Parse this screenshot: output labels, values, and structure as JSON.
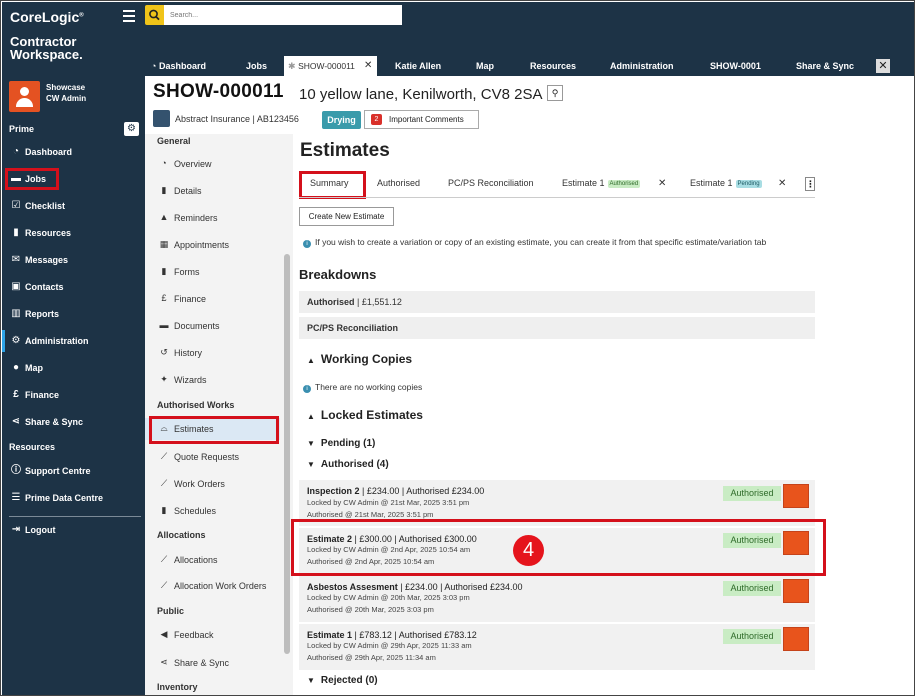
{
  "app": {
    "logo_text": "CoreLogic",
    "logo_mark": "®",
    "product_line1": "Contractor",
    "product_line2": "Workspace."
  },
  "user": {
    "name": "Showcase",
    "role": "CW Admin"
  },
  "sidebar": {
    "section_prime": "Prime",
    "section_resources": "Resources",
    "items": [
      {
        "label": "Dashboard",
        "icon": "dashboard-icon"
      },
      {
        "label": "Jobs",
        "icon": "folder-icon"
      },
      {
        "label": "Checklist",
        "icon": "checkbox-icon"
      },
      {
        "label": "Resources",
        "icon": "clipboard-icon"
      },
      {
        "label": "Messages",
        "icon": "envelope-icon"
      },
      {
        "label": "Contacts",
        "icon": "contact-card-icon"
      },
      {
        "label": "Reports",
        "icon": "chart-icon"
      },
      {
        "label": "Administration",
        "icon": "gear-icon"
      },
      {
        "label": "Map",
        "icon": "map-pin-icon"
      },
      {
        "label": "Finance",
        "icon": "pound-icon"
      },
      {
        "label": "Share & Sync",
        "icon": "share-icon"
      }
    ],
    "resource_items": [
      {
        "label": "Support Centre",
        "icon": "info-icon"
      },
      {
        "label": "Prime Data Centre",
        "icon": "database-icon"
      }
    ],
    "logout": "Logout"
  },
  "search": {
    "placeholder": "Search..."
  },
  "tabs": [
    {
      "label": "Dashboard"
    },
    {
      "label": "Jobs"
    },
    {
      "label": "SHOW-000011",
      "active": true
    },
    {
      "label": "Katie Allen"
    },
    {
      "label": "Map"
    },
    {
      "label": "Resources"
    },
    {
      "label": "Administration"
    },
    {
      "label": "SHOW-0001"
    },
    {
      "label": "Share & Sync"
    }
  ],
  "job": {
    "id": "SHOW-000011",
    "address": "10 yellow lane, Kenilworth, CV8 2SA",
    "insurer": "Abstract Insurance | AB123456",
    "status": "Drying",
    "important_count": "2",
    "important_label": "Important Comments"
  },
  "subnav": {
    "section_general": "General",
    "general_items": [
      {
        "label": "Overview",
        "icon": "overview-icon"
      },
      {
        "label": "Details",
        "icon": "document-icon"
      },
      {
        "label": "Reminders",
        "icon": "bell-icon"
      },
      {
        "label": "Appointments",
        "icon": "calendar-icon"
      },
      {
        "label": "Forms",
        "icon": "form-icon"
      },
      {
        "label": "Finance",
        "icon": "pound-icon"
      },
      {
        "label": "Documents",
        "icon": "folder-icon"
      },
      {
        "label": "History",
        "icon": "history-icon"
      },
      {
        "label": "Wizards",
        "icon": "wand-icon"
      }
    ],
    "section_authorised": "Authorised Works",
    "authorised_items": [
      {
        "label": "Estimates",
        "icon": "estimate-icon"
      },
      {
        "label": "Quote Requests",
        "icon": "hammer-icon"
      },
      {
        "label": "Work Orders",
        "icon": "wrench-icon"
      },
      {
        "label": "Schedules",
        "icon": "clipboard-icon"
      }
    ],
    "section_allocations": "Allocations",
    "allocation_items": [
      {
        "label": "Allocations",
        "icon": "wrench-icon"
      },
      {
        "label": "Allocation Work Orders",
        "icon": "wrench-icon"
      }
    ],
    "section_public": "Public",
    "public_items": [
      {
        "label": "Feedback",
        "icon": "megaphone-icon"
      },
      {
        "label": "Share & Sync",
        "icon": "share-icon"
      }
    ],
    "section_inventory": "Inventory"
  },
  "main": {
    "title": "Estimates",
    "tabs": {
      "summary": "Summary",
      "authorised": "Authorised",
      "reconciliation": "PC/PS Reconciliation",
      "estimate1a": "Estimate 1",
      "estimate1a_badge": "Authorised",
      "estimate1b": "Estimate 1",
      "estimate1b_badge": "Pending"
    },
    "create_button": "Create New Estimate",
    "info": "If you wish to create a variation or copy of an existing estimate, you can create it from that specific estimate/variation tab",
    "breakdowns_title": "Breakdowns",
    "breakdown_authorised_label": "Authorised",
    "breakdown_authorised_value": "| £1,551.12",
    "breakdown_reconciliation": "PC/PS Reconciliation",
    "working_copies_title": "Working Copies",
    "no_working_copies": "There are no working copies",
    "locked_title": "Locked Estimates",
    "pending_title": "Pending (1)",
    "authorised_title": "Authorised (4)",
    "rejected_title": "Rejected (0)",
    "step_number": "4",
    "estimates": [
      {
        "name": "Inspection 2",
        "detail": " | £234.00 | Authorised £234.00",
        "locked": "Locked by CW Admin @ 21st Mar, 2025 3:51 pm",
        "authorised": "Authorised @ 21st Mar, 2025 3:51 pm",
        "status": "Authorised"
      },
      {
        "name": "Estimate 2",
        "detail": " | £300.00 | Authorised £300.00",
        "locked": "Locked by CW Admin @ 2nd Apr, 2025 10:54 am",
        "authorised": "Authorised @ 2nd Apr, 2025 10:54 am",
        "status": "Authorised"
      },
      {
        "name": "Asbestos Assesment",
        "detail": " | £234.00 | Authorised £234.00",
        "locked": "Locked by CW Admin @ 20th Mar, 2025 3:03 pm",
        "authorised": "Authorised @ 20th Mar, 2025 3:03 pm",
        "status": "Authorised"
      },
      {
        "name": "Estimate 1",
        "detail": " | £783.12 | Authorised £783.12",
        "locked": "Locked by CW Admin @ 29th Apr, 2025 11:33 am",
        "authorised": "Authorised @ 29th Apr, 2025 11:34 am",
        "status": "Authorised"
      }
    ]
  },
  "colors": {
    "sidebar_bg": "#1d3346",
    "accent_orange": "#e8541c",
    "highlight_red": "#d4101b",
    "drying_badge": "#3a9bab",
    "authorised_badge": "#c9ecc4"
  }
}
